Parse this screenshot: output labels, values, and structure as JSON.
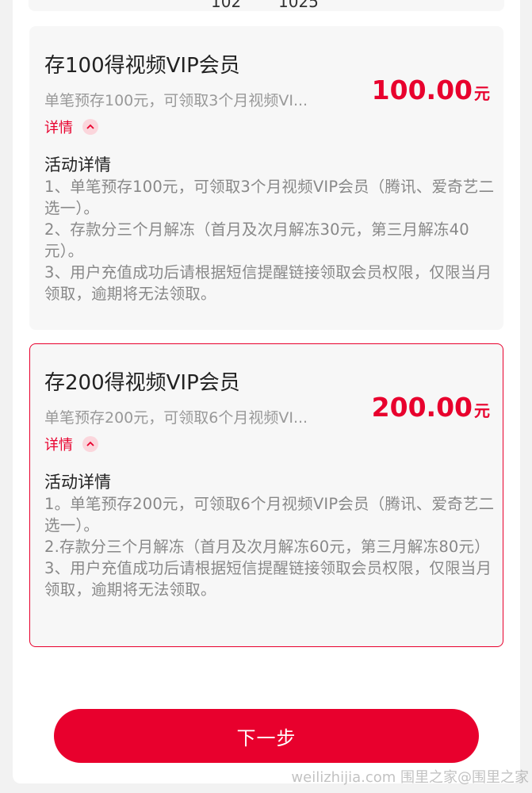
{
  "prev_card": {
    "fragment_left": "102",
    "fragment_right": "1025"
  },
  "offers": [
    {
      "title": "存100得视频VIP会员",
      "subtitle": "单笔预存100元，可领取3个月视频VI...",
      "price": "100.00",
      "unit": "元",
      "detail_toggle": "详情",
      "detail_heading": "活动详情",
      "detail_lines": [
        "1、单笔预存100元，可领取3个月视频VIP会员（腾讯、爱奇艺二选一）。",
        "2、存款分三个月解冻（首月及次月解冻30元，第三月解冻40元）。",
        "3、用户充值成功后请根据短信提醒链接领取会员权限，仅限当月领取，逾期将无法领取。"
      ],
      "selected": false
    },
    {
      "title": "存200得视频VIP会员",
      "subtitle": "单笔预存200元，可领取6个月视频VI...",
      "price": "200.00",
      "unit": "元",
      "detail_toggle": "详情",
      "detail_heading": "活动详情",
      "detail_lines": [
        "1。单笔预存200元，可领取6个月视频VIP会员（腾讯、爱奇艺二选一）。",
        "2.存款分三个月解冻（首月及次月解冻60元，第三月解冻80元）",
        "3、用户充值成功后请根据短信提醒链接领取会员权限，仅限当月领取，逾期将无法领取。"
      ],
      "selected": true
    }
  ],
  "next_button": "下一步",
  "watermark": "weilizhijia.com 围里之家@围里之家",
  "colors": {
    "accent": "#e8002d",
    "card_bg": "#f7f7f7",
    "muted_text": "#888888"
  },
  "icons": {
    "detail_toggle": "chevron-up-icon"
  }
}
